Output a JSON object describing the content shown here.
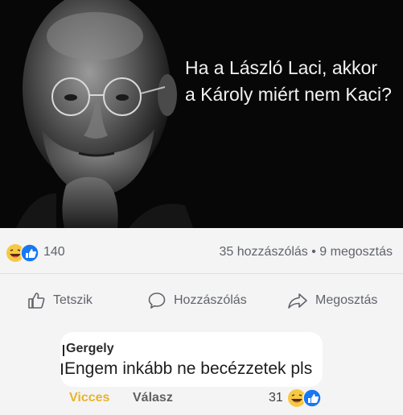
{
  "post": {
    "caption_line1": "Ha a László Laci, akkor",
    "caption_line2": "a Károly miért nem Kaci?"
  },
  "stats": {
    "reactions_count": "140",
    "share_info": "35 hozzászólás • 9 megosztás"
  },
  "actions": {
    "like_label": "Tetszik",
    "comment_label": "Hozzászólás",
    "share_label": "Megosztás"
  },
  "comment": {
    "author": "Gergely",
    "text": "Engem inkább ne becézzetek pls",
    "haha_label": "Vicces",
    "reply_label": "Válasz",
    "reaction_count": "31"
  },
  "colors": {
    "haha_yellow": "#f7c843",
    "like_blue": "#1877f2",
    "vicces_text": "#e8b42c"
  },
  "icons": [
    "haha-icon",
    "like-icon",
    "thumbs-up-icon",
    "comment-icon",
    "share-icon"
  ]
}
